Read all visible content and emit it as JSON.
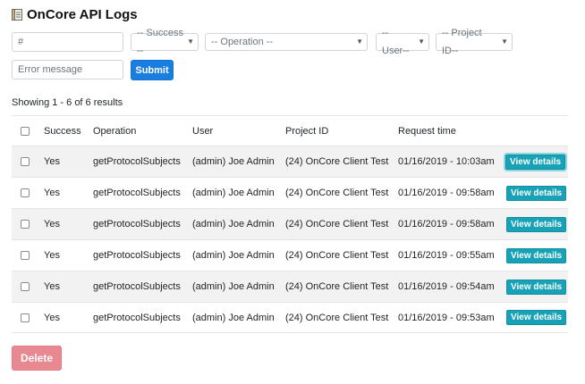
{
  "header": {
    "title": "OnCore API Logs",
    "icon": "document-icon"
  },
  "filters": {
    "id_placeholder": "#",
    "success_select": "-- Success --",
    "operation_select": "-- Operation --",
    "user_select": "-- User--",
    "project_select": "-- Project ID--",
    "error_placeholder": "Error message",
    "submit_label": "Submit"
  },
  "results": {
    "showing_text": "Showing 1 - 6 of 6 results"
  },
  "table": {
    "columns": [
      "Success",
      "Operation",
      "User",
      "Project ID",
      "Request time"
    ],
    "view_label": "View details",
    "rows": [
      {
        "success": "Yes",
        "operation": "getProtocolSubjects",
        "user": "(admin) Joe Admin",
        "project": "(24) OnCore Client Test",
        "time": "01/16/2019 - 10:03am"
      },
      {
        "success": "Yes",
        "operation": "getProtocolSubjects",
        "user": "(admin) Joe Admin",
        "project": "(24) OnCore Client Test",
        "time": "01/16/2019 - 09:58am"
      },
      {
        "success": "Yes",
        "operation": "getProtocolSubjects",
        "user": "(admin) Joe Admin",
        "project": "(24) OnCore Client Test",
        "time": "01/16/2019 - 09:58am"
      },
      {
        "success": "Yes",
        "operation": "getProtocolSubjects",
        "user": "(admin) Joe Admin",
        "project": "(24) OnCore Client Test",
        "time": "01/16/2019 - 09:55am"
      },
      {
        "success": "Yes",
        "operation": "getProtocolSubjects",
        "user": "(admin) Joe Admin",
        "project": "(24) OnCore Client Test",
        "time": "01/16/2019 - 09:54am"
      },
      {
        "success": "Yes",
        "operation": "getProtocolSubjects",
        "user": "(admin) Joe Admin",
        "project": "(24) OnCore Client Test",
        "time": "01/16/2019 - 09:53am"
      }
    ]
  },
  "actions": {
    "delete_label": "Delete"
  },
  "colors": {
    "primary": "#1a7de0",
    "info": "#17a2b8",
    "danger_disabled": "#e88891",
    "stripe": "#f2f2f2"
  }
}
